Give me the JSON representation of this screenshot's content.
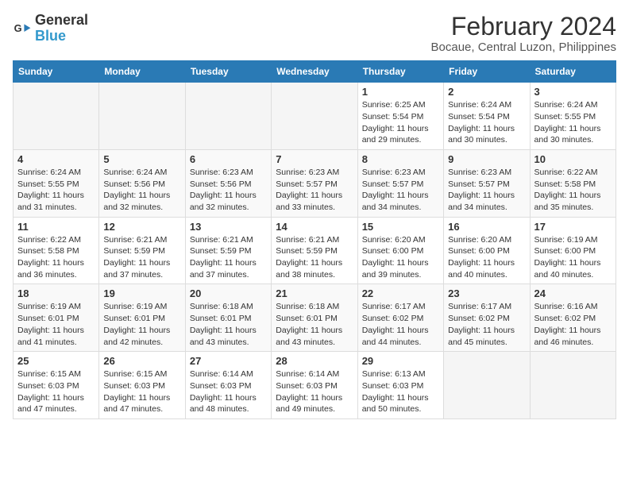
{
  "logo": {
    "line1": "General",
    "line2": "Blue"
  },
  "title": "February 2024",
  "subtitle": "Bocaue, Central Luzon, Philippines",
  "days_header": [
    "Sunday",
    "Monday",
    "Tuesday",
    "Wednesday",
    "Thursday",
    "Friday",
    "Saturday"
  ],
  "weeks": [
    [
      {
        "day": "",
        "sunrise": "",
        "sunset": "",
        "daylight": ""
      },
      {
        "day": "",
        "sunrise": "",
        "sunset": "",
        "daylight": ""
      },
      {
        "day": "",
        "sunrise": "",
        "sunset": "",
        "daylight": ""
      },
      {
        "day": "",
        "sunrise": "",
        "sunset": "",
        "daylight": ""
      },
      {
        "day": "1",
        "sunrise": "Sunrise: 6:25 AM",
        "sunset": "Sunset: 5:54 PM",
        "daylight": "Daylight: 11 hours and 29 minutes."
      },
      {
        "day": "2",
        "sunrise": "Sunrise: 6:24 AM",
        "sunset": "Sunset: 5:54 PM",
        "daylight": "Daylight: 11 hours and 30 minutes."
      },
      {
        "day": "3",
        "sunrise": "Sunrise: 6:24 AM",
        "sunset": "Sunset: 5:55 PM",
        "daylight": "Daylight: 11 hours and 30 minutes."
      }
    ],
    [
      {
        "day": "4",
        "sunrise": "Sunrise: 6:24 AM",
        "sunset": "Sunset: 5:55 PM",
        "daylight": "Daylight: 11 hours and 31 minutes."
      },
      {
        "day": "5",
        "sunrise": "Sunrise: 6:24 AM",
        "sunset": "Sunset: 5:56 PM",
        "daylight": "Daylight: 11 hours and 32 minutes."
      },
      {
        "day": "6",
        "sunrise": "Sunrise: 6:23 AM",
        "sunset": "Sunset: 5:56 PM",
        "daylight": "Daylight: 11 hours and 32 minutes."
      },
      {
        "day": "7",
        "sunrise": "Sunrise: 6:23 AM",
        "sunset": "Sunset: 5:57 PM",
        "daylight": "Daylight: 11 hours and 33 minutes."
      },
      {
        "day": "8",
        "sunrise": "Sunrise: 6:23 AM",
        "sunset": "Sunset: 5:57 PM",
        "daylight": "Daylight: 11 hours and 34 minutes."
      },
      {
        "day": "9",
        "sunrise": "Sunrise: 6:23 AM",
        "sunset": "Sunset: 5:57 PM",
        "daylight": "Daylight: 11 hours and 34 minutes."
      },
      {
        "day": "10",
        "sunrise": "Sunrise: 6:22 AM",
        "sunset": "Sunset: 5:58 PM",
        "daylight": "Daylight: 11 hours and 35 minutes."
      }
    ],
    [
      {
        "day": "11",
        "sunrise": "Sunrise: 6:22 AM",
        "sunset": "Sunset: 5:58 PM",
        "daylight": "Daylight: 11 hours and 36 minutes."
      },
      {
        "day": "12",
        "sunrise": "Sunrise: 6:21 AM",
        "sunset": "Sunset: 5:59 PM",
        "daylight": "Daylight: 11 hours and 37 minutes."
      },
      {
        "day": "13",
        "sunrise": "Sunrise: 6:21 AM",
        "sunset": "Sunset: 5:59 PM",
        "daylight": "Daylight: 11 hours and 37 minutes."
      },
      {
        "day": "14",
        "sunrise": "Sunrise: 6:21 AM",
        "sunset": "Sunset: 5:59 PM",
        "daylight": "Daylight: 11 hours and 38 minutes."
      },
      {
        "day": "15",
        "sunrise": "Sunrise: 6:20 AM",
        "sunset": "Sunset: 6:00 PM",
        "daylight": "Daylight: 11 hours and 39 minutes."
      },
      {
        "day": "16",
        "sunrise": "Sunrise: 6:20 AM",
        "sunset": "Sunset: 6:00 PM",
        "daylight": "Daylight: 11 hours and 40 minutes."
      },
      {
        "day": "17",
        "sunrise": "Sunrise: 6:19 AM",
        "sunset": "Sunset: 6:00 PM",
        "daylight": "Daylight: 11 hours and 40 minutes."
      }
    ],
    [
      {
        "day": "18",
        "sunrise": "Sunrise: 6:19 AM",
        "sunset": "Sunset: 6:01 PM",
        "daylight": "Daylight: 11 hours and 41 minutes."
      },
      {
        "day": "19",
        "sunrise": "Sunrise: 6:19 AM",
        "sunset": "Sunset: 6:01 PM",
        "daylight": "Daylight: 11 hours and 42 minutes."
      },
      {
        "day": "20",
        "sunrise": "Sunrise: 6:18 AM",
        "sunset": "Sunset: 6:01 PM",
        "daylight": "Daylight: 11 hours and 43 minutes."
      },
      {
        "day": "21",
        "sunrise": "Sunrise: 6:18 AM",
        "sunset": "Sunset: 6:01 PM",
        "daylight": "Daylight: 11 hours and 43 minutes."
      },
      {
        "day": "22",
        "sunrise": "Sunrise: 6:17 AM",
        "sunset": "Sunset: 6:02 PM",
        "daylight": "Daylight: 11 hours and 44 minutes."
      },
      {
        "day": "23",
        "sunrise": "Sunrise: 6:17 AM",
        "sunset": "Sunset: 6:02 PM",
        "daylight": "Daylight: 11 hours and 45 minutes."
      },
      {
        "day": "24",
        "sunrise": "Sunrise: 6:16 AM",
        "sunset": "Sunset: 6:02 PM",
        "daylight": "Daylight: 11 hours and 46 minutes."
      }
    ],
    [
      {
        "day": "25",
        "sunrise": "Sunrise: 6:15 AM",
        "sunset": "Sunset: 6:03 PM",
        "daylight": "Daylight: 11 hours and 47 minutes."
      },
      {
        "day": "26",
        "sunrise": "Sunrise: 6:15 AM",
        "sunset": "Sunset: 6:03 PM",
        "daylight": "Daylight: 11 hours and 47 minutes."
      },
      {
        "day": "27",
        "sunrise": "Sunrise: 6:14 AM",
        "sunset": "Sunset: 6:03 PM",
        "daylight": "Daylight: 11 hours and 48 minutes."
      },
      {
        "day": "28",
        "sunrise": "Sunrise: 6:14 AM",
        "sunset": "Sunset: 6:03 PM",
        "daylight": "Daylight: 11 hours and 49 minutes."
      },
      {
        "day": "29",
        "sunrise": "Sunrise: 6:13 AM",
        "sunset": "Sunset: 6:03 PM",
        "daylight": "Daylight: 11 hours and 50 minutes."
      },
      {
        "day": "",
        "sunrise": "",
        "sunset": "",
        "daylight": ""
      },
      {
        "day": "",
        "sunrise": "",
        "sunset": "",
        "daylight": ""
      }
    ]
  ]
}
